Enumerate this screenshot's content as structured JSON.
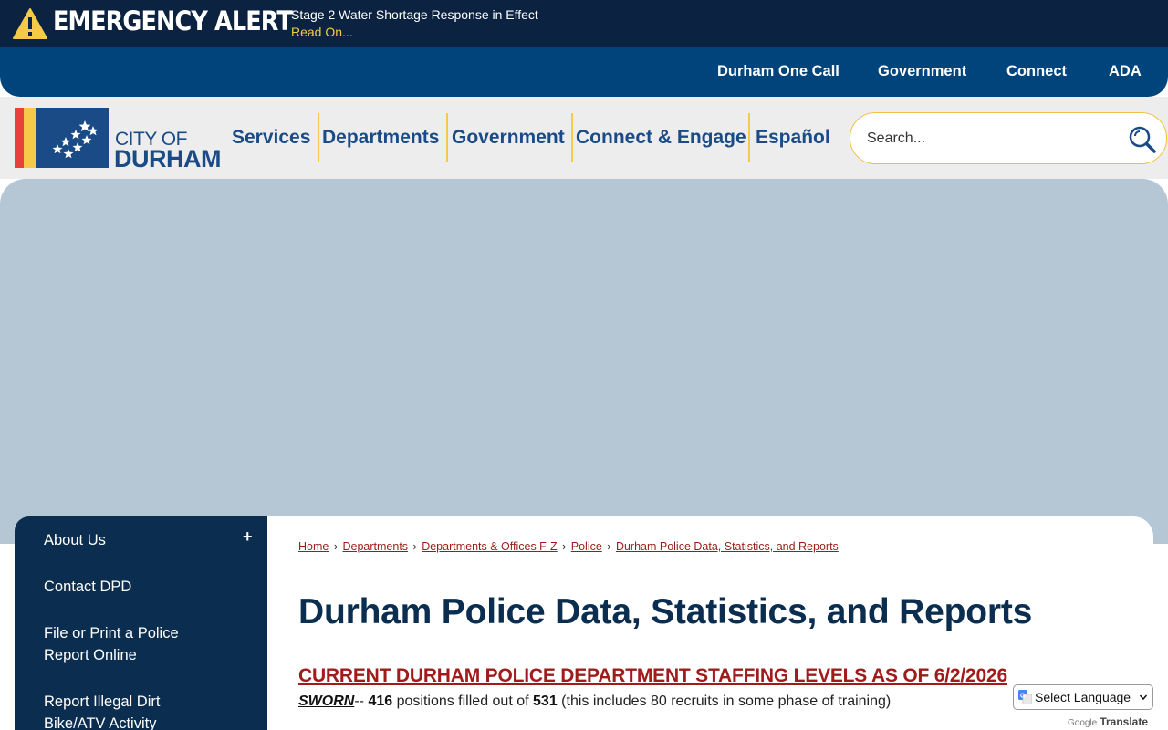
{
  "alert": {
    "title": "EMERGENCY ALERT",
    "message": "Stage 2 Water Shortage Response in Effect",
    "link_label": "Read On..."
  },
  "utility_nav": {
    "items": [
      "Durham One Call",
      "Government",
      "Connect",
      "ADA"
    ]
  },
  "logo": {
    "city_of": "CITY OF",
    "durham": "DURHAM"
  },
  "main_nav": {
    "items": [
      "Services",
      "Departments",
      "Government",
      "Connect & Engage",
      "Español"
    ]
  },
  "search": {
    "placeholder": "Search..."
  },
  "sidebar": {
    "items": [
      {
        "label": "About Us",
        "expander": "+"
      },
      {
        "label": "Contact DPD"
      },
      {
        "label": "File or Print a Police Report Online"
      },
      {
        "label": "Report Illegal Dirt Bike/ATV Activity"
      }
    ]
  },
  "breadcrumb": {
    "items": [
      "Home",
      "Departments",
      "Departments & Offices F-Z",
      "Police",
      "Durham Police Data, Statistics, and Reports"
    ],
    "separator": "›"
  },
  "page": {
    "title": "Durham Police Data, Statistics, and Reports",
    "staffing_heading": "CURRENT DURHAM POLICE DEPARTMENT STAFFING LEVELS AS OF 6/2/2026",
    "sworn_label": "SWORN",
    "sworn_dash": "-- ",
    "sworn_filled": "416",
    "sworn_text1": " positions filled out of ",
    "sworn_total": "531",
    "sworn_text2": " (this includes 80 recruits in some phase of training)"
  },
  "translate": {
    "select_label": "Select Language",
    "powered_google": "Google",
    "powered_translate": "Translate"
  },
  "colors": {
    "alert_bg": "#0b2240",
    "utility_bg": "#00447c",
    "brand_blue": "#1a4b86",
    "accent_yellow": "#f7c948",
    "link_red": "#9b1b1b",
    "sidebar_bg": "#0b2d4f"
  }
}
